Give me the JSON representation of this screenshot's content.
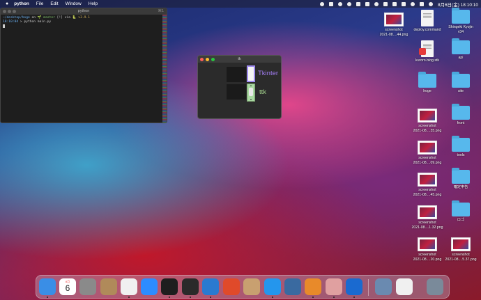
{
  "menubar": {
    "app_name": "python",
    "menus": [
      "File",
      "Edit",
      "Window",
      "Help"
    ],
    "datetime": "8月6日(金) 18:10:10"
  },
  "terminal": {
    "title": "python",
    "shortcut": "⌘1",
    "line1_path": "~/desktop/hoge",
    "line1_on": " on ",
    "line1_branch": "🌱 master",
    "line1_flags": " [!] via ",
    "line1_version": "🐍 v3.9.1",
    "line2_time": "18:10:04",
    "line2_cmd": " > python main.py"
  },
  "tkwindow": {
    "title": "tk",
    "tk_label": "Tkinter",
    "ttk_label": "ttk",
    "colors": {
      "tk_label": "#a07cf0",
      "ttk_label": "#a8d890"
    }
  },
  "desktop": {
    "items": [
      {
        "name": "screenshot-1",
        "type": "shot",
        "label": "screenshot\n2021-08....44.png"
      },
      {
        "name": "deploy-command",
        "type": "doc",
        "label": "deploy.command"
      },
      {
        "name": "shingeki-kyojin",
        "type": "folder",
        "label": "Shingeki Kyojin\nv34"
      },
      {
        "name": "kuroro-blog",
        "type": "pdf",
        "label": "kuroro.blog.stk"
      },
      {
        "name": "api",
        "type": "folder",
        "label": "api"
      },
      {
        "name": "hoge",
        "type": "folder",
        "label": "hoge"
      },
      {
        "name": "site",
        "type": "folder",
        "label": "site"
      },
      {
        "name": "screenshot-2",
        "type": "shot",
        "label": "screenshot\n2021-08....35.png"
      },
      {
        "name": "front",
        "type": "folder",
        "label": "front"
      },
      {
        "name": "screenshot-3",
        "type": "shot",
        "label": "screenshot\n2021-08....09.png"
      },
      {
        "name": "tools",
        "type": "folder",
        "label": "tools"
      },
      {
        "name": "screenshot-4",
        "type": "shot",
        "label": "screenshot\n2021-08....45.png"
      },
      {
        "name": "kakutei",
        "type": "folder",
        "label": "確定申告"
      },
      {
        "name": "screenshot-5",
        "type": "shot",
        "label": "screenshot\n2021-08....1.32.png"
      },
      {
        "name": "logo",
        "type": "folder",
        "label": "ロゴ"
      },
      {
        "name": "screenshot-6",
        "type": "shot",
        "label": "screenshot\n2021-08....20.png"
      },
      {
        "name": "screenshot-7",
        "type": "shot",
        "label": "screenshot\n2021-08....5.37.png"
      }
    ]
  },
  "dock": {
    "calendar_month": "8月",
    "calendar_day": "6",
    "apps": [
      {
        "name": "finder",
        "color": "#3a8ee6"
      },
      {
        "name": "calendar",
        "color": "#ffffff"
      },
      {
        "name": "system-preferences",
        "color": "#8a8a8a"
      },
      {
        "name": "contacts",
        "color": "#b08a5a"
      },
      {
        "name": "chrome",
        "color": "#f0f0f0"
      },
      {
        "name": "zoom",
        "color": "#2d8cff"
      },
      {
        "name": "activity-monitor",
        "color": "#1e1e1e"
      },
      {
        "name": "terminal",
        "color": "#2a2a2a"
      },
      {
        "name": "vscode",
        "color": "#2a7ad0"
      },
      {
        "name": "reporter",
        "color": "#e04a2a"
      },
      {
        "name": "archive-utility",
        "color": "#c8a070"
      },
      {
        "name": "docker",
        "color": "#2496ed"
      },
      {
        "name": "quicktime",
        "color": "#3a6aa0"
      },
      {
        "name": "sourcetree",
        "color": "#e88a2a"
      },
      {
        "name": "preview",
        "color": "#e0a0a0"
      },
      {
        "name": "infinity",
        "color": "#1a6ad0"
      },
      {
        "name": "downloads",
        "color": "#6a8ab0"
      },
      {
        "name": "document",
        "color": "#f0f0f0"
      },
      {
        "name": "trash",
        "color": "#7a8a9a"
      }
    ]
  }
}
